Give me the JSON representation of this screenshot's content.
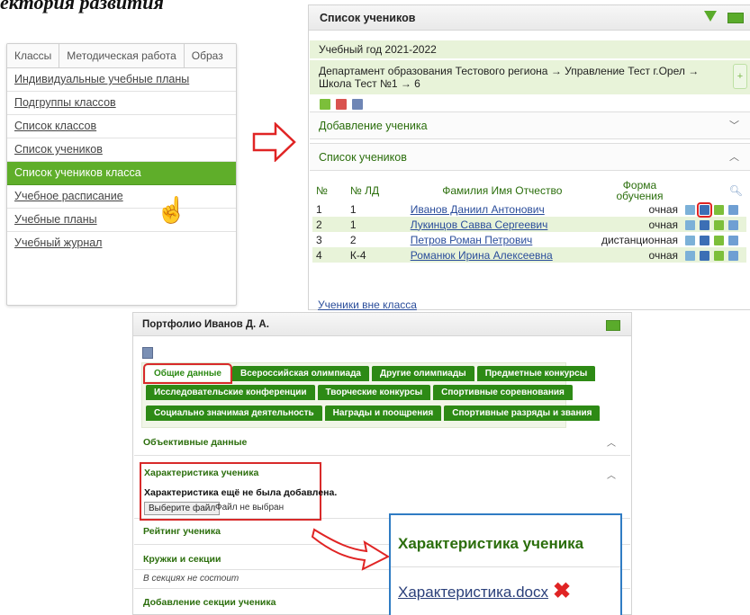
{
  "heading": "ектория развития",
  "menu": {
    "tabs": [
      "Классы",
      "Методическая работа",
      "Образ"
    ],
    "items": [
      {
        "label": "Индивидуальные учебные планы",
        "active": false
      },
      {
        "label": "Подгруппы классов",
        "active": false
      },
      {
        "label": "Список классов",
        "active": false
      },
      {
        "label": "Список учеников",
        "active": false
      },
      {
        "label": "Список учеников класса",
        "active": true
      },
      {
        "label": "Учебное расписание",
        "active": false
      },
      {
        "label": "Учебные планы",
        "active": false
      },
      {
        "label": "Учебный журнал",
        "active": false
      }
    ]
  },
  "students_panel": {
    "title": "Список учеников",
    "year": "Учебный год 2021-2022",
    "path": "Департамент образования Тестового региона → Управление Тест г.Орел → Школа Тест №1 → 6",
    "add_section": "Добавление ученика",
    "list_section": "Список учеников",
    "columns": {
      "num": "№",
      "ld": "№ ЛД",
      "fio": "Фамилия Имя Отчество",
      "form_line1": "Форма",
      "form_line2": "обучения"
    },
    "rows": [
      {
        "num": "1",
        "ld": "1",
        "fio": "Иванов Даниил Антонович",
        "form": "очная"
      },
      {
        "num": "2",
        "ld": "1",
        "fio": "Лукинцов Савва Сергеевич",
        "form": "очная"
      },
      {
        "num": "3",
        "ld": "2",
        "fio": "Петров Роман Петрович",
        "form": "дистанционная"
      },
      {
        "num": "4",
        "ld": "К-4",
        "fio": "Романюк Ирина Алексеевна",
        "form": "очная"
      }
    ],
    "outside_link": "Ученики вне класса"
  },
  "portfolio": {
    "title": "Портфолио Иванов Д. А.",
    "tabs_row1": [
      "Общие данные",
      "Всероссийская олимпиада",
      "Другие олимпиады",
      "Предметные конкурсы"
    ],
    "tabs_row2": [
      "Исследовательские конференции",
      "Творческие конкурсы",
      "Спортивные соревнования"
    ],
    "tabs_row3": [
      "Социально значимая деятельность",
      "Награды и поощрения",
      "Спортивные разряды и звания"
    ],
    "objective": "Объективные данные",
    "characteristic": "Характеристика ученика",
    "char_message": "Характеристика ещё не была добавлена.",
    "file_button": "Выберите файл",
    "file_none": "Файл не выбран",
    "rating": "Рейтинг ученика",
    "clubs": "Кружки и секции",
    "clubs_note": "В секциях не состоит",
    "add_club": "Добавление секции ученика"
  },
  "zoom": {
    "title": "Характеристика ученика",
    "file": "Характеристика.docx"
  },
  "colors": {
    "accent_green": "#5fae2a",
    "dark_green": "#2d8a15",
    "highlight_red": "#e02424",
    "callout_blue": "#2f7cc4"
  }
}
